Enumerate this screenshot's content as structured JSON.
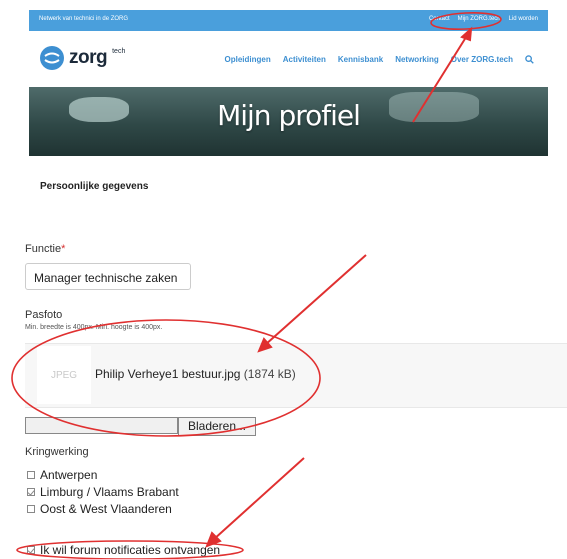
{
  "topbar": {
    "tagline": "Netwerk van technici in de ZORG",
    "links": [
      "Contact",
      "Mijn ZORG.tech",
      "Lid worden"
    ]
  },
  "brand": {
    "name": "zorg",
    "suffix": "tech"
  },
  "menu": [
    "Opleidingen",
    "Activiteiten",
    "Kennisbank",
    "Networking",
    "Over ZORG.tech"
  ],
  "banner": {
    "title": "Mijn profiel"
  },
  "section": {
    "title": "Persoonlijke gegevens"
  },
  "functie": {
    "label": "Functie",
    "required_mark": "*",
    "value": "Manager technische zaken"
  },
  "pasfoto": {
    "label": "Pasfoto",
    "hint": "Min. breedte is 400px. Min. hoogte is 400px.",
    "thumb_label": "JPEG",
    "filename": "Philip Verheye1 bestuur.jpg",
    "filesize": "(1874 kB)",
    "browse_label": "Bladeren..."
  },
  "kringwerking": {
    "label": "Kringwerking",
    "options": [
      {
        "label": "Antwerpen",
        "checked": false
      },
      {
        "label": "Limburg / Vlaams Brabant",
        "checked": true
      },
      {
        "label": "Oost & West Vlaanderen",
        "checked": false
      }
    ]
  },
  "forum": {
    "label": "Ik wil forum notificaties ontvangen",
    "checked": true
  },
  "colors": {
    "accent": "#3d8fd1",
    "topbar": "#4a9fdc",
    "annotation": "#e03030"
  }
}
